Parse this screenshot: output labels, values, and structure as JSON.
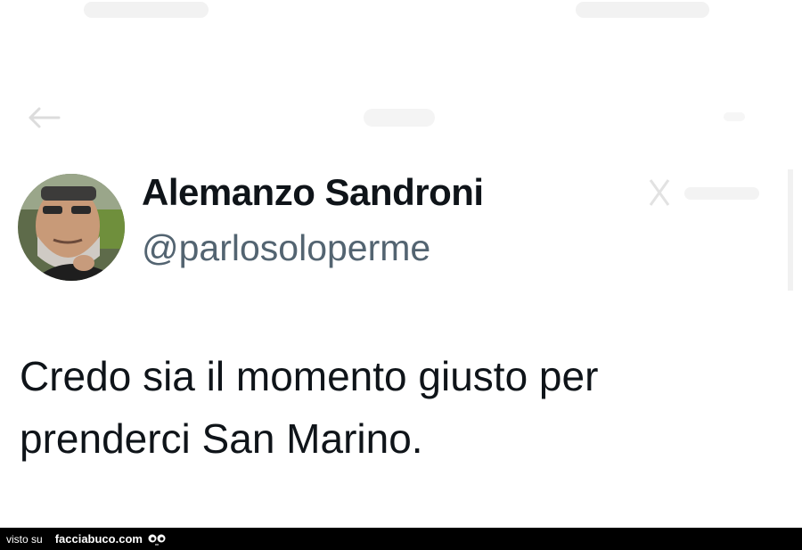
{
  "author": {
    "name": "Alemanzo Sandroni",
    "handle": "@parlosoloperme"
  },
  "tweet": {
    "lines": [
      "Credo sia il momento giusto per",
      "prenderci San Marino."
    ]
  },
  "footer": {
    "prefix": "visto su",
    "site": "facciabuco.com"
  },
  "icons": {
    "back": "back-arrow-icon",
    "x_logo": "x-logo-icon",
    "mascot": "eyes-icon"
  },
  "colors": {
    "text": "#0f1419",
    "handle": "#536471",
    "footer_bg": "#000000"
  }
}
